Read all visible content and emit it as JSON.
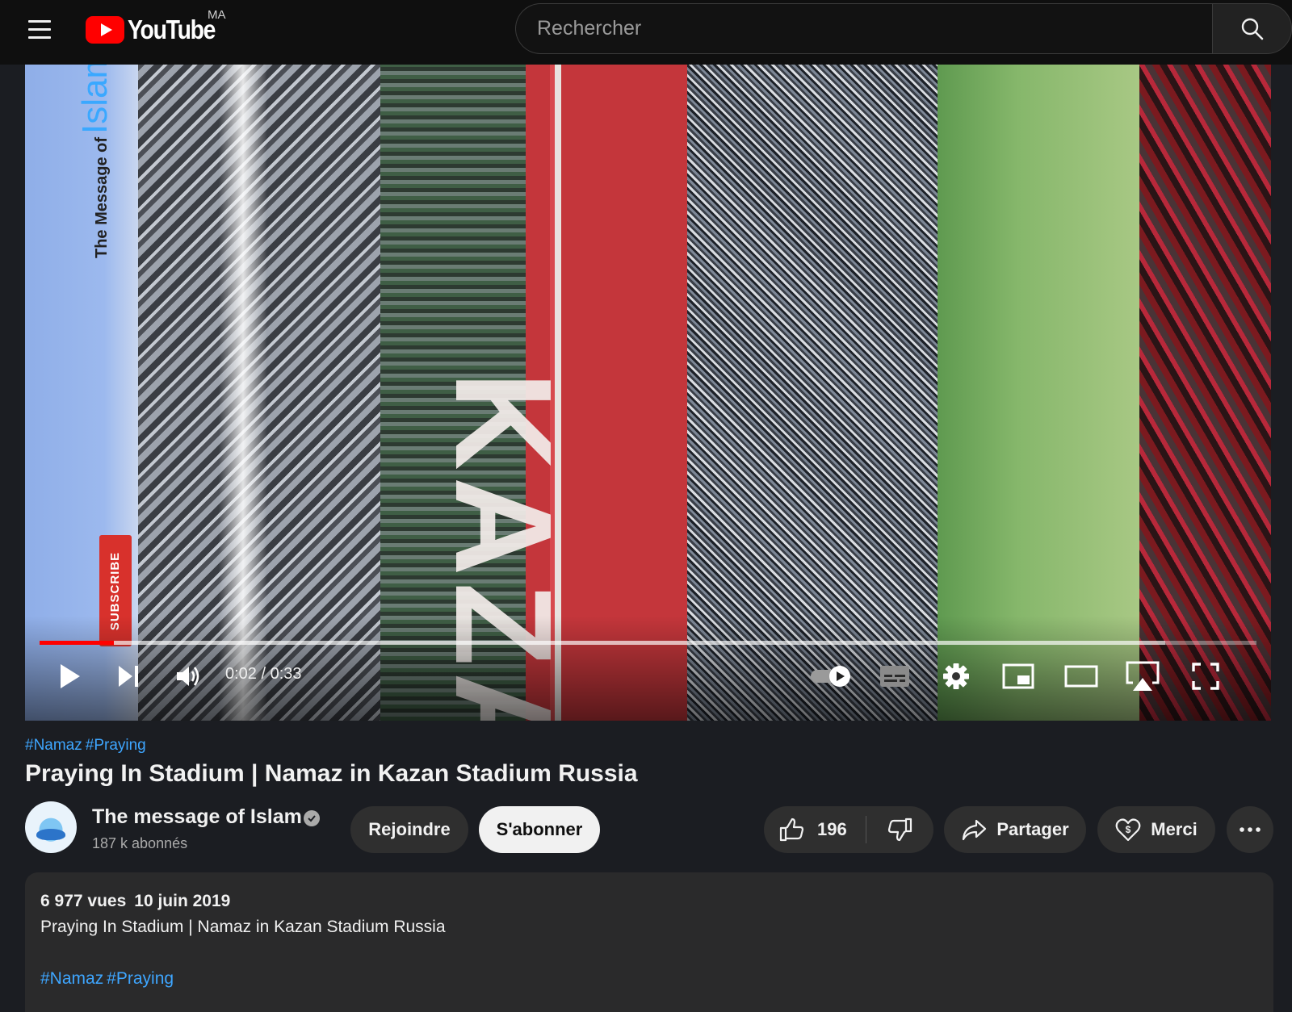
{
  "header": {
    "logo_text": "YouTube",
    "region": "MA",
    "search_placeholder": "Rechercher"
  },
  "player": {
    "time": "0:02 / 0:33",
    "progress_fraction": 0.061,
    "buffer_fraction": 0.925,
    "autoplay_on": true,
    "watermark_small": "The Message of",
    "watermark_large": "Islam",
    "subscribe_overlay": "SUBSCRIBE",
    "banner_text": "KAZAN"
  },
  "video": {
    "hashtags": [
      "#Namaz",
      "#Praying"
    ],
    "title": "Praying In Stadium | Namaz in Kazan Stadium Russia"
  },
  "channel": {
    "name": "The message of Islam",
    "subscribers": "187 k abonnés",
    "join_label": "Rejoindre",
    "subscribe_label": "S'abonner"
  },
  "actions": {
    "likes": "196",
    "share_label": "Partager",
    "thanks_label": "Merci"
  },
  "description": {
    "views": "6 977 vues",
    "date": "10 juin 2019",
    "text": "Praying In Stadium | Namaz in Kazan Stadium Russia",
    "hashtags": [
      "#Namaz",
      "#Praying"
    ]
  },
  "colors": {
    "accent_red": "#ff0000",
    "link_blue": "#3ea6ff",
    "background": "#1b1d22"
  }
}
